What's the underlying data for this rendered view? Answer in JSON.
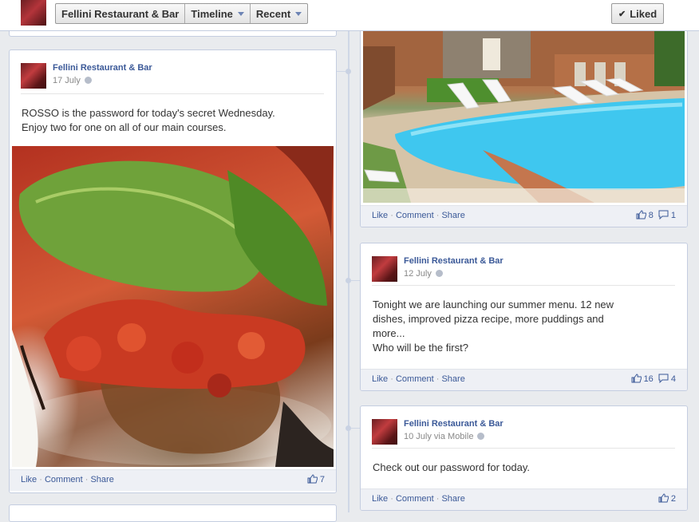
{
  "header": {
    "page_name": "Fellini Restaurant & Bar",
    "timeline_label": "Timeline",
    "recent_label": "Recent",
    "liked_label": "Liked"
  },
  "posts": [
    {
      "author": "Fellini Restaurant & Bar",
      "date": "17 July",
      "text": "ROSSO is the password for today's secret Wednesday.\nEnjoy two for one on all of our main courses.",
      "like_label": "Like",
      "comment_label": "Comment",
      "share_label": "Share",
      "likes": "7"
    },
    {
      "like_label": "Like",
      "comment_label": "Comment",
      "share_label": "Share",
      "likes": "8",
      "comments": "1"
    },
    {
      "author": "Fellini Restaurant & Bar",
      "date": "12 July",
      "text": "Tonight we are launching our summer menu. 12 new\ndishes, improved pizza recipe, more puddings and\nmore...\nWho will be the first?",
      "like_label": "Like",
      "comment_label": "Comment",
      "share_label": "Share",
      "likes": "16",
      "comments": "4"
    },
    {
      "author": "Fellini Restaurant & Bar",
      "date": "10 July via Mobile",
      "text": "Check out our password for today.",
      "like_label": "Like",
      "comment_label": "Comment",
      "share_label": "Share",
      "likes": "2"
    }
  ],
  "separator": "·",
  "icons": {
    "caret": "chevron-down-icon",
    "check": "check-icon",
    "like": "thumbs-up-icon",
    "comment": "comment-icon",
    "privacy": "globe-icon"
  },
  "colors": {
    "link": "#3b5998",
    "page_bg": "#e9ebee",
    "card_border": "#c4cde0"
  }
}
